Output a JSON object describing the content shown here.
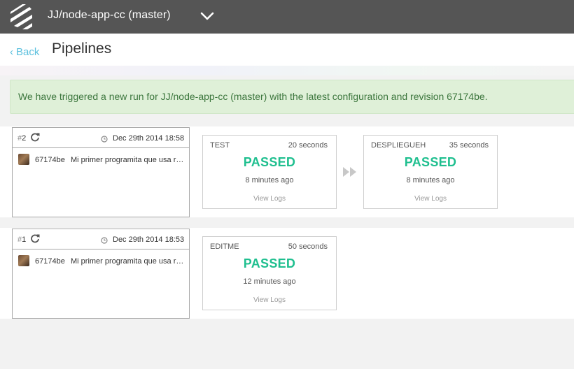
{
  "header": {
    "repo_title": "JJ/node-app-cc (master)",
    "logo_icon": "stacked-bars-logo",
    "dropdown_icon": "chevron-down-icon"
  },
  "subheader": {
    "back_label": "Back",
    "page_title": "Pipelines"
  },
  "alert": {
    "message": "We have triggered a new run for JJ/node-app-cc (master) with the latest configuration and revision 67174be."
  },
  "runs": [
    {
      "number": "2",
      "date": "Dec 29th 2014 18:58",
      "commit_sha": "67174be",
      "commit_message": "Mi primer programita que usa redis",
      "stages": [
        {
          "name": "TEST",
          "duration": "20 seconds",
          "status": "PASSED",
          "ago": "8 minutes ago",
          "logs_label": "View Logs"
        },
        {
          "name": "DESPLIEGUEH",
          "duration": "35 seconds",
          "status": "PASSED",
          "ago": "8 minutes ago",
          "logs_label": "View Logs"
        }
      ]
    },
    {
      "number": "1",
      "date": "Dec 29th 2014 18:53",
      "commit_sha": "67174be",
      "commit_message": "Mi primer programita que usa redis",
      "stages": [
        {
          "name": "EDITME",
          "duration": "50 seconds",
          "status": "PASSED",
          "ago": "12 minutes ago",
          "logs_label": "View Logs"
        }
      ]
    }
  ],
  "colors": {
    "topbar": "#555555",
    "passed": "#1fbf8f",
    "link": "#5bc0de",
    "alert_bg": "#dff0d8",
    "alert_text": "#3c763d"
  }
}
